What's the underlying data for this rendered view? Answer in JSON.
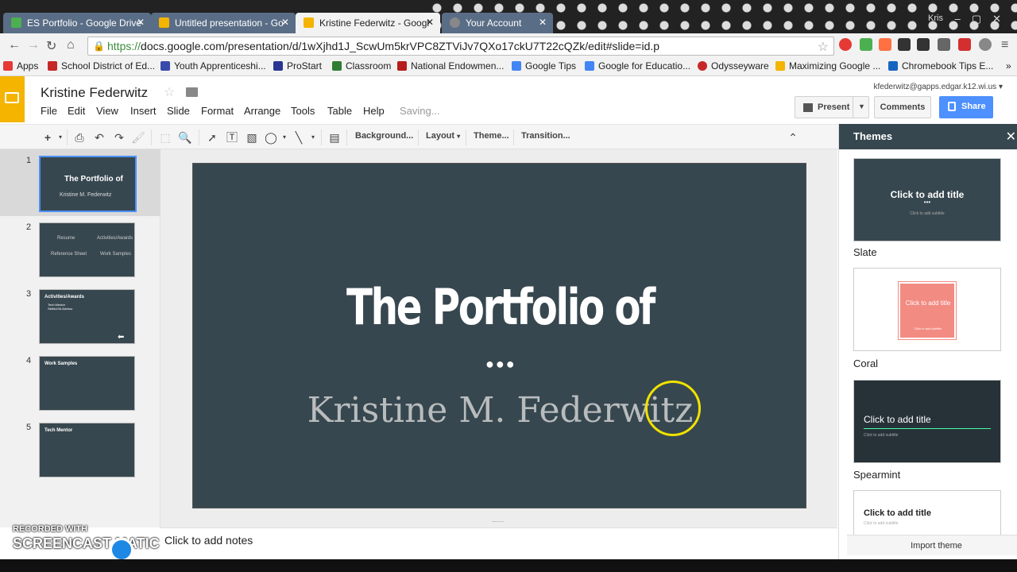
{
  "browser": {
    "tabs": [
      {
        "title": "ES Portfolio - Google Drive",
        "icon": "google-drive-icon",
        "color": "#4caf50",
        "active": false
      },
      {
        "title": "Untitled presentation - Go",
        "icon": "slides-icon",
        "color": "#f4b400",
        "active": false
      },
      {
        "title": "Kristine Federwitz - Googl",
        "icon": "slides-icon",
        "color": "#f4b400",
        "active": true
      },
      {
        "title": "Your Account",
        "icon": "account-icon",
        "color": "#888888",
        "active": false
      }
    ],
    "user": "Kris",
    "url_scheme": "https://",
    "url_rest": "docs.google.com/presentation/d/1wXjhd1J_ScwUm5krVPC8ZTViJv7QXo17ckU7T22cQZk/edit#slide=id.p",
    "bookmarks": [
      {
        "label": "Apps",
        "color": "#e53935"
      },
      {
        "label": "School District of Ed...",
        "color": "#c62828"
      },
      {
        "label": "Youth Apprenticeshi...",
        "color": "#3949ab"
      },
      {
        "label": "ProStart",
        "color": "#283593"
      },
      {
        "label": "Classroom",
        "color": "#2e7d32"
      },
      {
        "label": "National Endowmen...",
        "color": "#b71c1c"
      },
      {
        "label": "Google Tips",
        "color": "#4285f4"
      },
      {
        "label": "Google for Educatio...",
        "color": "#4285f4"
      },
      {
        "label": "Odysseyware",
        "color": "#c62828"
      },
      {
        "label": "Maximizing Google ...",
        "color": "#f4b400"
      },
      {
        "label": "Chromebook Tips E...",
        "color": "#1565c0"
      }
    ]
  },
  "docs": {
    "title": "Kristine Federwitz",
    "account": "kfederwitz@gapps.edgar.k12.wi.us",
    "menus": [
      "File",
      "Edit",
      "View",
      "Insert",
      "Slide",
      "Format",
      "Arrange",
      "Tools",
      "Table",
      "Help"
    ],
    "status": "Saving...",
    "present_label": "Present",
    "comments_label": "Comments",
    "share_label": "Share"
  },
  "toolbar": {
    "background": "Background...",
    "layout": "Layout",
    "theme": "Theme...",
    "transition": "Transition..."
  },
  "slides": [
    {
      "num": "1",
      "lines": [
        "The Portfolio of",
        "Kristine M. Federwitz"
      ]
    },
    {
      "num": "2",
      "lines": [
        "Resume",
        "Activities/Awards",
        "Reference Sheet",
        "Work Samples"
      ]
    },
    {
      "num": "3",
      "lines": [
        "Activities/Awards",
        "Tech Mentor",
        "SkillsUSA Advisor"
      ]
    },
    {
      "num": "4",
      "lines": [
        "Work Samples"
      ]
    },
    {
      "num": "5",
      "lines": [
        "Tech Mentor"
      ]
    }
  ],
  "current_slide": {
    "title": "The Portfolio of",
    "subtitle": "Kristine M. Federwitz"
  },
  "notes_placeholder": "Click to add notes",
  "themes": {
    "title": "Themes",
    "items": [
      {
        "name": "Slate",
        "preview_title": "Click to add title",
        "preview_sub": "Click to add subtitle",
        "bg": "#37474f"
      },
      {
        "name": "Coral",
        "preview_title": "Click to add title",
        "preview_sub": "Click to add subtitle",
        "bg": "#f28b82"
      },
      {
        "name": "Spearmint",
        "preview_title": "Click to add title",
        "preview_sub": "Click to add subtitle",
        "bg": "#263238"
      },
      {
        "name": "",
        "preview_title": "Click to add title",
        "preview_sub": "Click to add subtitle",
        "bg": "#ffffff"
      }
    ],
    "import_label": "Import theme"
  },
  "watermark": {
    "line1": "RECORDED WITH",
    "line2": "SCREENCAST MATIC"
  }
}
